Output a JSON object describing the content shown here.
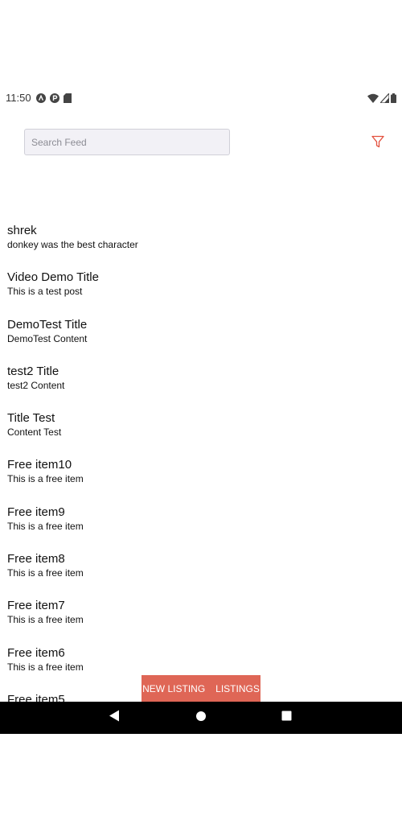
{
  "status_bar": {
    "time": "11:50",
    "left_icons": [
      "notification-a-icon",
      "notification-p-icon",
      "sd-card-icon"
    ],
    "right_icons": [
      "wifi-icon",
      "signal-icon",
      "battery-icon"
    ]
  },
  "search": {
    "placeholder": "Search Feed",
    "value": ""
  },
  "filter": {
    "icon": "filter-icon",
    "color": "#e3503e"
  },
  "feed": [
    {
      "title": "shrek",
      "content": "donkey was the best character"
    },
    {
      "title": "Video Demo Title",
      "content": "This is a test post"
    },
    {
      "title": "DemoTest Title",
      "content": "DemoTest Content"
    },
    {
      "title": "test2 Title",
      "content": "test2 Content"
    },
    {
      "title": "Title Test",
      "content": "Content Test"
    },
    {
      "title": "Free item10",
      "content": "This is a free item"
    },
    {
      "title": "Free item9",
      "content": "This is a free item"
    },
    {
      "title": "Free item8",
      "content": "This is a free item"
    },
    {
      "title": "Free item7",
      "content": "This is a free item"
    },
    {
      "title": "Free item6",
      "content": "This is a free item"
    },
    {
      "title": "Free item5",
      "content": ""
    }
  ],
  "bottom_tabs": {
    "background": "#df6656",
    "new_listing_label": "NEW LISTING",
    "listings_label": "LISTINGS"
  },
  "nav_bar": {
    "icons": [
      "back-icon",
      "home-icon",
      "recents-icon"
    ]
  }
}
